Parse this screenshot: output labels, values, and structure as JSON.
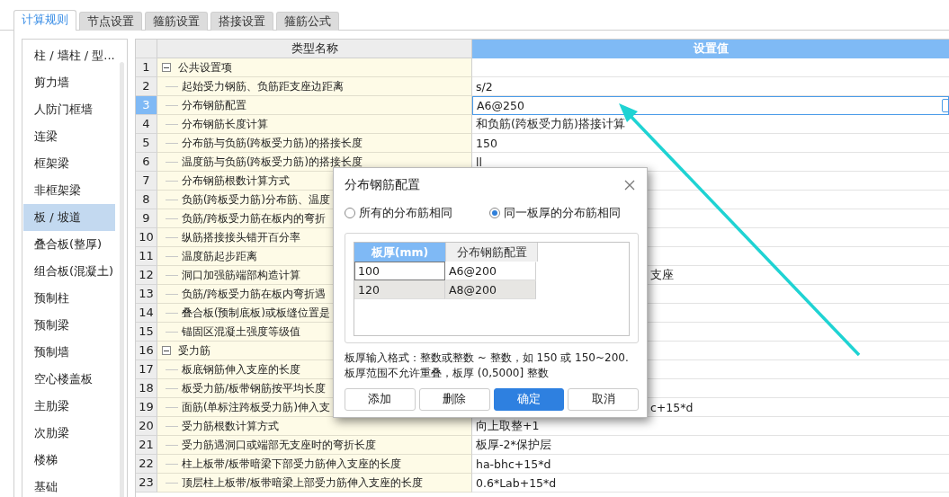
{
  "tabs": [
    {
      "label": "计算规则",
      "selected": true
    },
    {
      "label": "节点设置",
      "selected": false
    },
    {
      "label": "箍筋设置",
      "selected": false
    },
    {
      "label": "搭接设置",
      "selected": false
    },
    {
      "label": "箍筋公式",
      "selected": false
    }
  ],
  "sidebar": {
    "items": [
      {
        "label": "柱 / 墙柱 / 型...",
        "selected": false
      },
      {
        "label": "剪力墙",
        "selected": false
      },
      {
        "label": "人防门框墙",
        "selected": false
      },
      {
        "label": "连梁",
        "selected": false
      },
      {
        "label": "框架梁",
        "selected": false
      },
      {
        "label": "非框架梁",
        "selected": false
      },
      {
        "label": "板 / 坡道",
        "selected": true
      },
      {
        "label": "叠合板(整厚)",
        "selected": false
      },
      {
        "label": "组合板(混凝土)",
        "selected": false
      },
      {
        "label": "预制柱",
        "selected": false
      },
      {
        "label": "预制梁",
        "selected": false
      },
      {
        "label": "预制墙",
        "selected": false
      },
      {
        "label": "空心楼盖板",
        "selected": false
      },
      {
        "label": "主肋梁",
        "selected": false
      },
      {
        "label": "次肋梁",
        "selected": false
      },
      {
        "label": "楼梯",
        "selected": false
      },
      {
        "label": "基础",
        "selected": false
      }
    ]
  },
  "table": {
    "columns": [
      "类型名称",
      "设置值"
    ],
    "rows": [
      {
        "number": "1",
        "kind": "group",
        "expanded": true,
        "name": "公共设置项",
        "selected": false
      },
      {
        "number": "2",
        "kind": "item",
        "name": "起始受力钢筋、负筋距支座边距离",
        "value": "s/2",
        "selected": false
      },
      {
        "number": "3",
        "kind": "item",
        "name": "分布钢筋配置",
        "value": "A6@250",
        "selected": true
      },
      {
        "number": "4",
        "kind": "item",
        "name": "分布钢筋长度计算",
        "value": "和负筋(跨板受力筋)搭接计算",
        "selected": false
      },
      {
        "number": "5",
        "kind": "item",
        "name": "分布筋与负筋(跨板受力筋)的搭接长度",
        "value": "150",
        "selected": false
      },
      {
        "number": "6",
        "kind": "item",
        "name": "温度筋与负筋(跨板受力筋)的搭接长度",
        "value": "ll",
        "selected": false
      },
      {
        "number": "7",
        "kind": "item",
        "name": "分布钢筋根数计算方式",
        "selected": false
      },
      {
        "number": "8",
        "kind": "item",
        "name": "负筋(跨板受力筋)分布筋、温度",
        "selected": false
      },
      {
        "number": "9",
        "kind": "item",
        "name": "负筋/跨板受力筋在板内的弯折",
        "selected": false
      },
      {
        "number": "10",
        "kind": "item",
        "name": "纵筋搭接接头错开百分率",
        "selected": false
      },
      {
        "number": "11",
        "kind": "item",
        "name": "温度筋起步距离",
        "selected": false
      },
      {
        "number": "12",
        "kind": "item",
        "name": "洞口加强筋端部构造计算",
        "value_tail": "支座",
        "selected": false
      },
      {
        "number": "13",
        "kind": "item",
        "name": "负筋/跨板受力筋在板内弯折遇",
        "selected": false
      },
      {
        "number": "14",
        "kind": "item",
        "name": "叠合板(预制底板)或板缝位置是",
        "selected": false
      },
      {
        "number": "15",
        "kind": "item",
        "name": "锚固区混凝土强度等级值",
        "selected": false
      },
      {
        "number": "16",
        "kind": "group",
        "expanded": true,
        "name": "受力筋",
        "selected": false
      },
      {
        "number": "17",
        "kind": "item",
        "name": "板底钢筋伸入支座的长度",
        "selected": false
      },
      {
        "number": "18",
        "kind": "item",
        "name": "板受力筋/板带钢筋按平均长度",
        "selected": false
      },
      {
        "number": "19",
        "kind": "item",
        "name": "面筋(单标注跨板受力筋)伸入支",
        "value_tail": "c+15*d",
        "selected": false
      },
      {
        "number": "20",
        "kind": "item",
        "name": "受力筋根数计算方式",
        "value": "向上取整+1",
        "selected": false
      },
      {
        "number": "21",
        "kind": "item",
        "name": "受力筋遇洞口或端部无支座时的弯折长度",
        "value": "板厚-2*保护层",
        "selected": false
      },
      {
        "number": "22",
        "kind": "item",
        "name": "柱上板带/板带暗梁下部受力筋伸入支座的长度",
        "value": "ha-bhc+15*d",
        "selected": false
      },
      {
        "number": "23",
        "kind": "item",
        "name": "顶层柱上板带/板带暗梁上部受力筋伸入支座的长度",
        "value": "0.6*Lab+15*d",
        "selected": false
      }
    ]
  },
  "dialog": {
    "title": "分布钢筋配置",
    "options": [
      {
        "label": "所有的分布筋相同",
        "selected": false
      },
      {
        "label": "同一板厚的分布筋相同",
        "selected": true
      }
    ],
    "grid": {
      "columns": [
        {
          "label": "板厚(mm)",
          "selected": true
        },
        {
          "label": "分布钢筋配置",
          "selected": false
        }
      ],
      "rows": [
        {
          "cells": [
            "100",
            "A6@200"
          ],
          "selected": false,
          "focused": true
        },
        {
          "cells": [
            "120",
            "A8@200"
          ],
          "selected": true,
          "focused": false
        }
      ]
    },
    "notes": [
      "板厚输入格式：整数或整数 ~ 整数，如 150 或 150~200.",
      "板厚范围不允许重叠，板厚 (0,5000] 整数"
    ],
    "buttons": [
      {
        "label": "添加",
        "primary": false
      },
      {
        "label": "删除",
        "primary": false
      },
      {
        "label": "确定",
        "primary": true
      },
      {
        "label": "取消",
        "primary": false
      }
    ]
  }
}
